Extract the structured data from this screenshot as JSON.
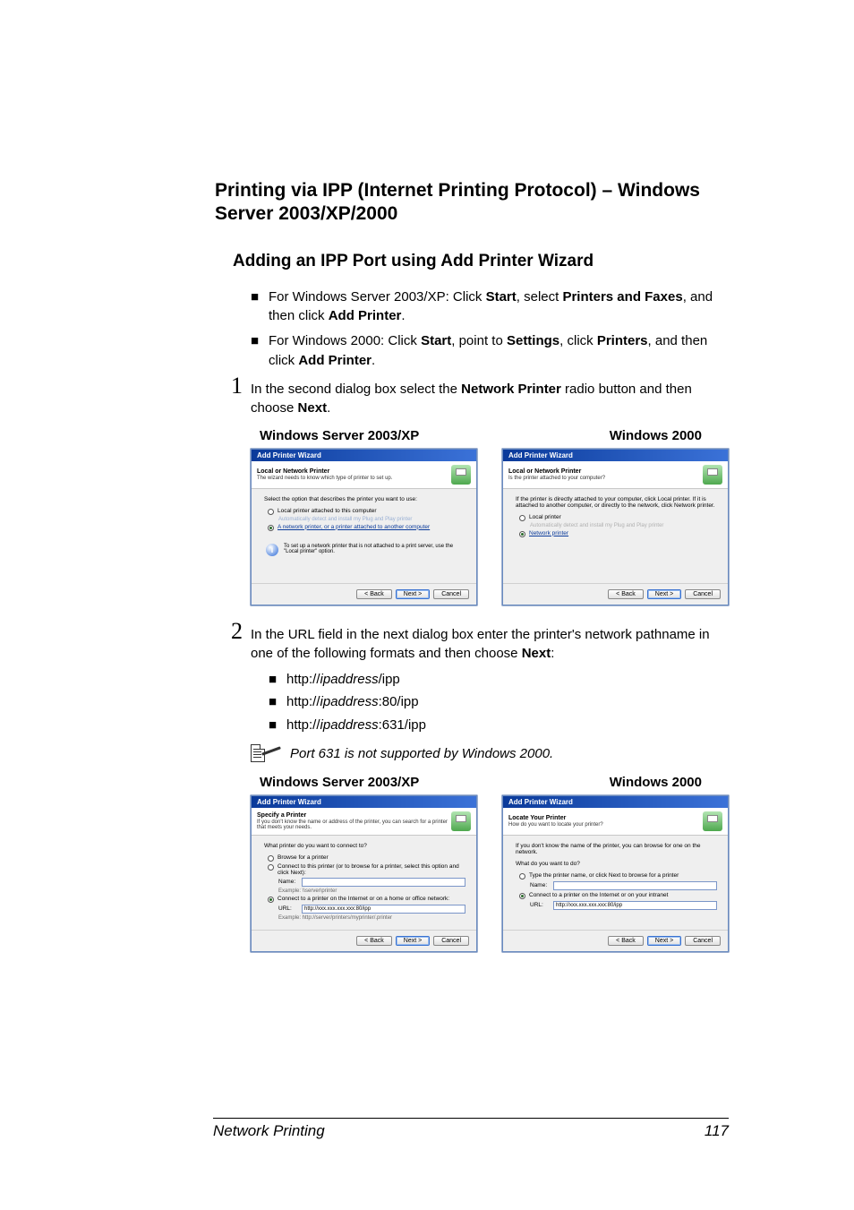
{
  "heading": "Printing via IPP (Internet Printing Protocol) – Windows Server 2003/XP/2000",
  "subheading": "Adding an IPP Port using Add Printer Wizard",
  "intro_bullets": [
    {
      "pre": "For Windows Server 2003/XP: Click ",
      "b1": "Start",
      "mid1": ", select ",
      "b2": "Printers and Faxes",
      "mid2": ", and then click ",
      "b3": "Add Printer",
      "post": "."
    },
    {
      "pre": "For Windows 2000: Click ",
      "b1": "Start",
      "mid1": ", point to ",
      "b2": "Settings",
      "mid2": ", click ",
      "b3": "Printers",
      "mid3": ", and then click ",
      "b4": "Add Printer",
      "post": "."
    }
  ],
  "step1": {
    "num": "1",
    "pre": "In the second dialog box select the ",
    "b1": "Network Printer",
    "mid": " radio button and then choose ",
    "b2": "Next",
    "post": "."
  },
  "columns": {
    "left": "Windows Server 2003/XP",
    "right": "Windows 2000"
  },
  "wiz_common": {
    "title": "Add Printer Wizard",
    "back": "< Back",
    "next": "Next >",
    "cancel": "Cancel"
  },
  "wiz1_xp": {
    "header": "Local or Network Printer",
    "subheader": "The wizard needs to know which type of printer to set up.",
    "lead": "Select the option that describes the printer you want to use:",
    "opt1": "Local printer attached to this computer",
    "opt1_sub": "Automatically detect and install my Plug and Play printer",
    "opt2": "A network printer, or a printer attached to another computer",
    "info": "To set up a network printer that is not attached to a print server, use the \"Local printer\" option."
  },
  "wiz1_2000": {
    "header": "Local or Network Printer",
    "subheader": "Is the printer attached to your computer?",
    "lead": "If the printer is directly attached to your computer, click Local printer. If it is attached to another computer, or directly to the network, click Network printer.",
    "opt1": "Local printer",
    "opt1_sub": "Automatically detect and install my Plug and Play printer",
    "opt2": "Network printer"
  },
  "step2": {
    "num": "2",
    "pre": "In the URL field in the next dialog box enter the printer's network pathname in one of the following formats and then choose ",
    "b1": "Next",
    "post": ":"
  },
  "url_bullets": [
    {
      "pre": "http://",
      "addr": "ipaddress",
      "post": "/ipp"
    },
    {
      "pre": "http://",
      "addr": "ipaddress",
      "post": ":80/ipp"
    },
    {
      "pre": "http://",
      "addr": "ipaddress",
      "post": ":631/ipp"
    }
  ],
  "note": "Port 631 is not supported by Windows 2000.",
  "wiz2_xp": {
    "header": "Specify a Printer",
    "subheader": "If you don't know the name or address of the printer, you can search for a printer that meets your needs.",
    "lead": "What printer do you want to connect to?",
    "opt1": "Browse for a printer",
    "opt2": "Connect to this printer (or to browse for a printer, select this option and click Next):",
    "name_lbl": "Name:",
    "name_ex": "Example: \\\\server\\printer",
    "opt3": "Connect to a printer on the Internet or on a home or office network:",
    "url_lbl": "URL:",
    "url_val": "http://xxx.xxx.xxx.xxx:80/ipp",
    "url_ex": "Example: http://server/printers/myprinter/.printer"
  },
  "wiz2_2000": {
    "header": "Locate Your Printer",
    "subheader": "How do you want to locate your printer?",
    "lead": "If you don't know the name of the printer, you can browse for one on the network.",
    "q": "What do you want to do?",
    "opt1": "Type the printer name, or click Next to browse for a printer",
    "name_lbl": "Name:",
    "opt2": "Connect to a printer on the Internet or on your intranet",
    "url_lbl": "URL:",
    "url_val": "http://xxx.xxx.xxx.xxx:80/ipp"
  },
  "footer": {
    "section": "Network Printing",
    "page": "117"
  }
}
